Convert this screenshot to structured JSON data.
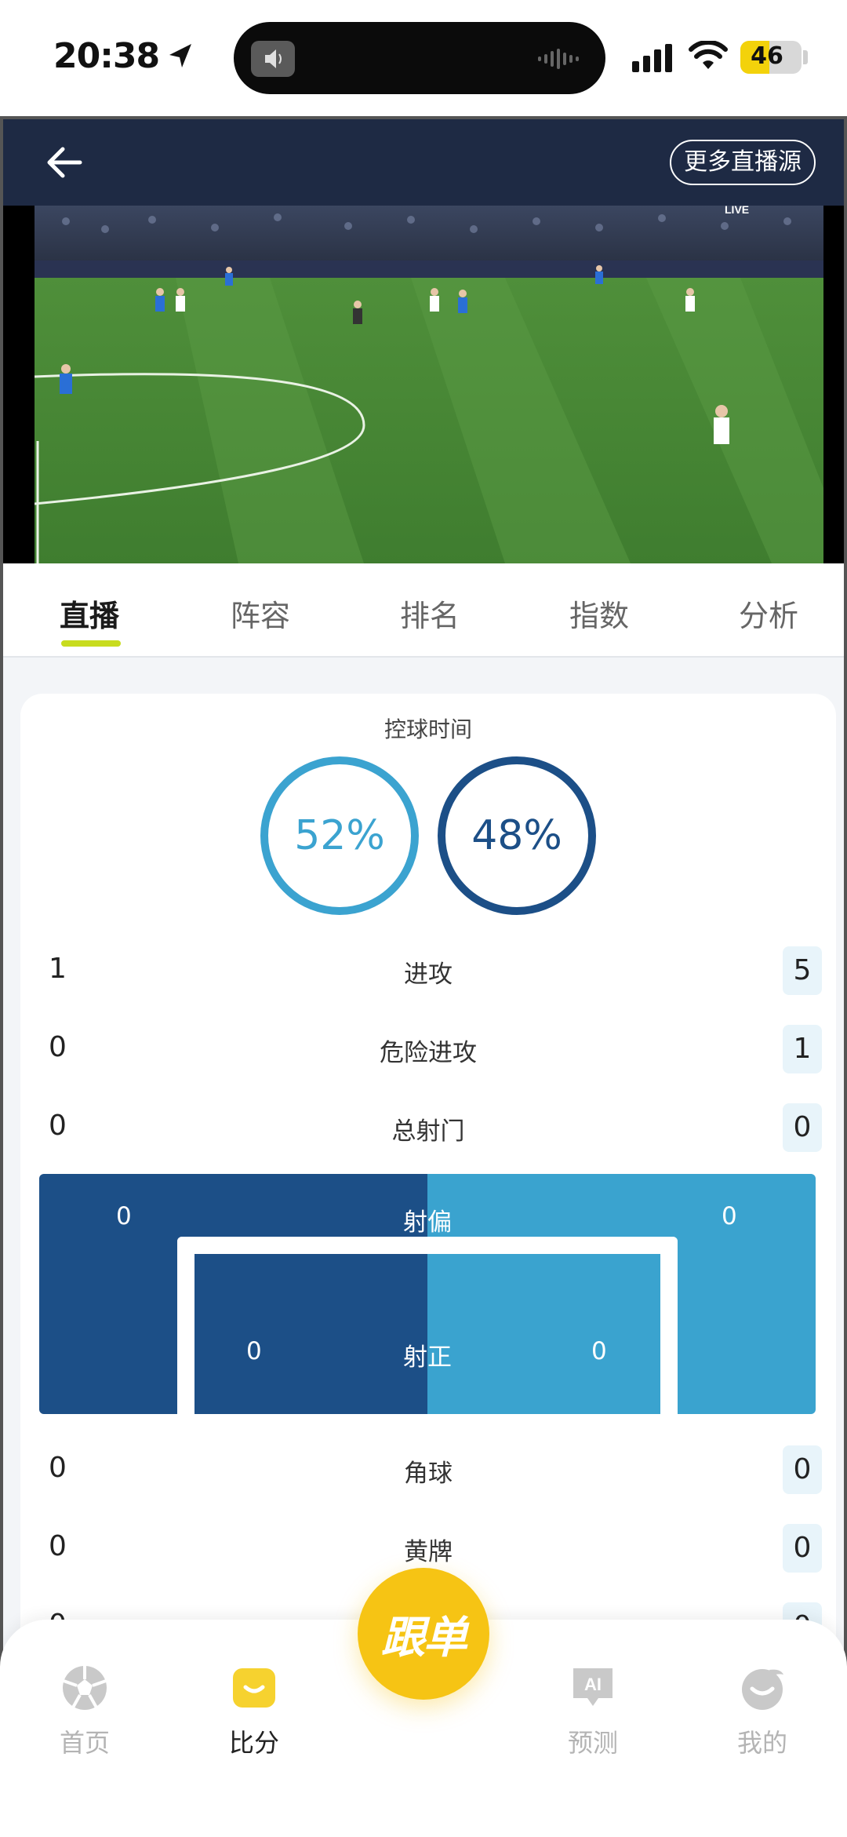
{
  "status_bar": {
    "time": "20:38",
    "battery": "46"
  },
  "header": {
    "more_sources_label": "更多直播源"
  },
  "video": {
    "live_badge": "LIVE"
  },
  "tabs": [
    {
      "label": "直播",
      "active": true
    },
    {
      "label": "阵容",
      "active": false
    },
    {
      "label": "排名",
      "active": false
    },
    {
      "label": "指数",
      "active": false
    },
    {
      "label": "分析",
      "active": false
    }
  ],
  "possession": {
    "title": "控球时间",
    "home": "52%",
    "away": "48%"
  },
  "stats_top": [
    {
      "label": "进攻",
      "home": "1",
      "away": "5"
    },
    {
      "label": "危险进攻",
      "home": "0",
      "away": "1"
    },
    {
      "label": "总射门",
      "home": "0",
      "away": "0"
    }
  ],
  "shots": {
    "off_target_label": "射偏",
    "off_target_home": "0",
    "off_target_away": "0",
    "on_target_label": "射正",
    "on_target_home": "0",
    "on_target_away": "0"
  },
  "stats_bottom": [
    {
      "label": "角球",
      "home": "0",
      "away": "0"
    },
    {
      "label": "黄牌",
      "home": "0",
      "away": "0"
    },
    {
      "label": "",
      "home": "0",
      "away": "0"
    }
  ],
  "bottom_nav": {
    "items": [
      {
        "label": "首页",
        "icon": "soccer-ball-icon"
      },
      {
        "label": "比分",
        "icon": "score-icon"
      },
      {
        "label": "预测",
        "icon": "ai-predict-icon"
      },
      {
        "label": "我的",
        "icon": "profile-icon"
      }
    ],
    "center_label": "跟单"
  },
  "colors": {
    "home": "#3ba3d0",
    "away": "#1c4f87",
    "accent": "#c8dc1e",
    "center_button": "#f6c414",
    "header_bg": "#1e2a44"
  }
}
